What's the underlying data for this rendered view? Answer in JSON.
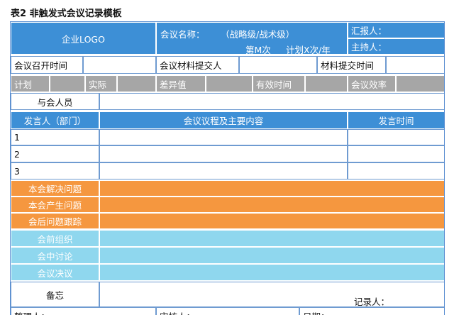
{
  "caption": "表2 非触发式会议记录模板",
  "header": {
    "logo": "企业LOGO",
    "meeting_name": "会议名称：",
    "level": "（战略级/战术级）",
    "month": "第M次",
    "plan": "计划X次/年",
    "reporter": "汇报人：",
    "host": "主持人："
  },
  "row_time": {
    "convene_time": "会议召开时间",
    "material_submitter": "会议材料提交人",
    "submit_time": "材料提交时间"
  },
  "row_stats": {
    "plan": "计划",
    "actual": "实际",
    "variance": "差异值",
    "effective_time": "有效时间",
    "efficiency": "会议效率"
  },
  "attendees": "与会人员",
  "table_header": {
    "speaker": "发言人（部门）",
    "agenda": "会议议程及主要内容",
    "speak_time": "发言时间"
  },
  "rows": [
    "1",
    "2",
    "3"
  ],
  "issues": [
    "本会解决问题",
    "本会产生问题",
    "会后问题跟踪"
  ],
  "sections": [
    "会前组织",
    "会中讨论",
    "会议决议"
  ],
  "memo": "备忘",
  "recorder": "记录人：",
  "footer": {
    "organizer": "整理人：",
    "reviewer": "审核人：",
    "date": "日期："
  }
}
